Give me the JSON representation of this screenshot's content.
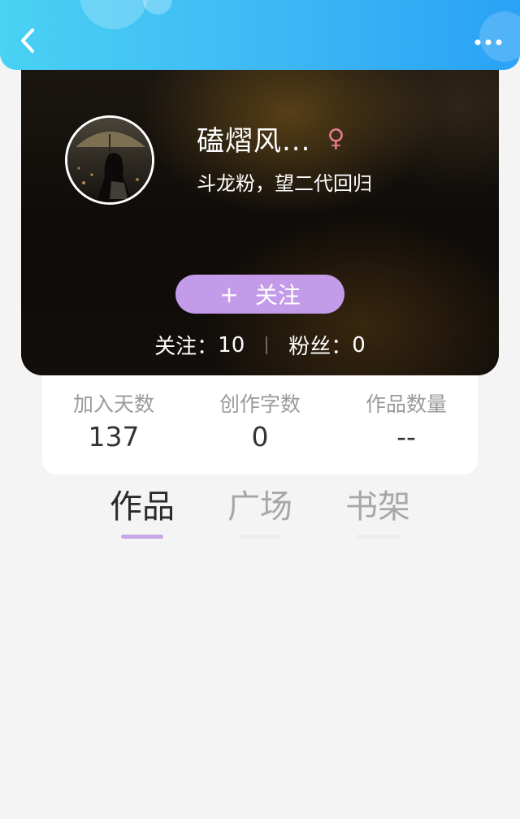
{
  "header": {
    "back_icon": "chevron-left-icon",
    "more_icon": "ellipsis-icon",
    "gradient_colors": [
      "#49d2f3",
      "#2aa2f6"
    ]
  },
  "profile": {
    "nickname": "磕熠风...",
    "gender_symbol": "♀",
    "gender_icon": "female-icon",
    "gender_color": "#e07b8f",
    "bio": "斗龙粉，望二代回归",
    "follow_button": {
      "plus": "+",
      "label": "关注",
      "color": "#c39be8"
    },
    "following": {
      "label": "关注：",
      "value": "10"
    },
    "followers": {
      "label": "粉丝：",
      "value": "0"
    }
  },
  "stats": [
    {
      "label": "加入天数",
      "value": "137"
    },
    {
      "label": "创作字数",
      "value": "0"
    },
    {
      "label": "作品数量",
      "value": "--"
    }
  ],
  "tabs": [
    {
      "label": "作品",
      "active": true
    },
    {
      "label": "广场",
      "active": false
    },
    {
      "label": "书架",
      "active": false
    }
  ],
  "accent_color": "#c8a6e8"
}
